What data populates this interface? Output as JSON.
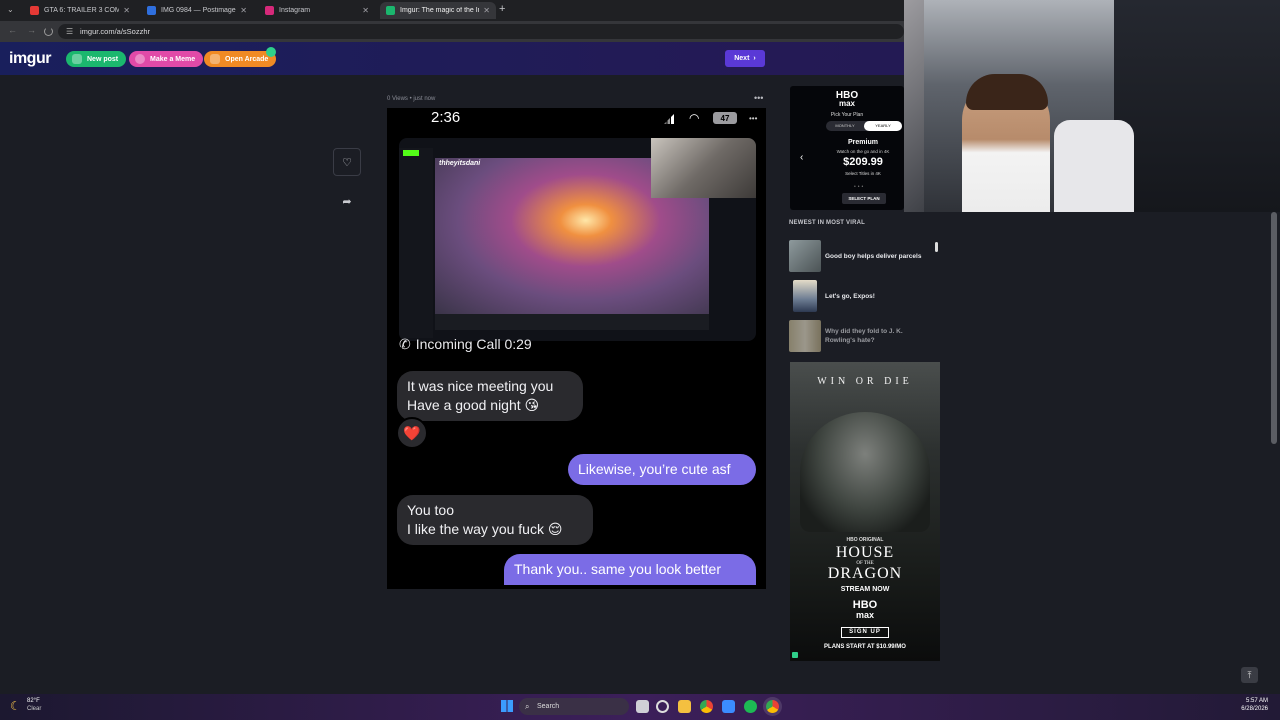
{
  "browser": {
    "tabs": [
      {
        "label": "GTA 6: TRAILER 3 COMPLETO! | ",
        "favicon_color": "#e53935"
      },
      {
        "label": "IMG 0984 — Postimages",
        "favicon_color": "#2f6fde"
      },
      {
        "label": "Instagram",
        "favicon_color": "#d6297a"
      },
      {
        "label": "Imgur: The magic of the Interne",
        "favicon_color": "#1bb76e"
      }
    ],
    "url": "imgur.com/a/sSozzhr"
  },
  "imgur": {
    "logo": "imgur",
    "buttons": {
      "new_post": "New post",
      "make_meme": "Make a Meme",
      "open_arcade": "Open Arcade",
      "next": "Next"
    },
    "colors": {
      "new_post": "#1bb76e",
      "make_meme": "#e14aa8",
      "open_arcade": "#f08a24",
      "next": "#5a39d6"
    }
  },
  "post": {
    "meta": "0 Views • just now",
    "phone_time": "2:36",
    "battery": "47",
    "streamer_name": "thheyitsdani",
    "incoming_call": "Incoming Call 0:29",
    "messages": [
      {
        "dir": "in",
        "line1": "It was nice meeting you",
        "line2": "Have a good night 😘"
      },
      {
        "dir": "reaction",
        "text": "❤️"
      },
      {
        "dir": "out",
        "line1": "Likewise, you’re cute asf"
      },
      {
        "dir": "in",
        "line1": "You too",
        "line2": "I like the way you fuck 😌"
      },
      {
        "dir": "out",
        "line1": "Thank you.. same you look better"
      }
    ]
  },
  "sidebar": {
    "ad_top": {
      "brand": "HBO",
      "brand_sub": "max",
      "headline": "Pick Your Plan",
      "toggle": [
        "MONTHLY",
        "YEARLY"
      ],
      "plan": "Premium",
      "desc": "Watch on the go and in 4K",
      "price": "$209.99",
      "note": "Select Titles in 4K",
      "cta": "SELECT PLAN"
    },
    "viral_heading": "NEWEST IN MOST VIRAL",
    "viral": [
      {
        "title": "Good boy helps deliver parcels"
      },
      {
        "title": "Let's go, Expos!"
      },
      {
        "title": "Why did they fold to J. K. Rowling's hate?"
      }
    ],
    "ad_bottom": {
      "tagline": "WIN OR DIE",
      "hbo_original": "HBO ORIGINAL",
      "title1": "HOUSE",
      "title_mid": "OF THE",
      "title2": "DRAGON",
      "stream": "STREAM NOW",
      "brand": "HBO",
      "brand_sub": "max",
      "cta": "SIGN UP",
      "price": "PLANS START AT $10.99/MO"
    }
  },
  "taskbar": {
    "weather_temp": "82°F",
    "weather_desc": "Clear",
    "search": "Search",
    "time": "5:57 AM",
    "date": "6/28/2026"
  }
}
